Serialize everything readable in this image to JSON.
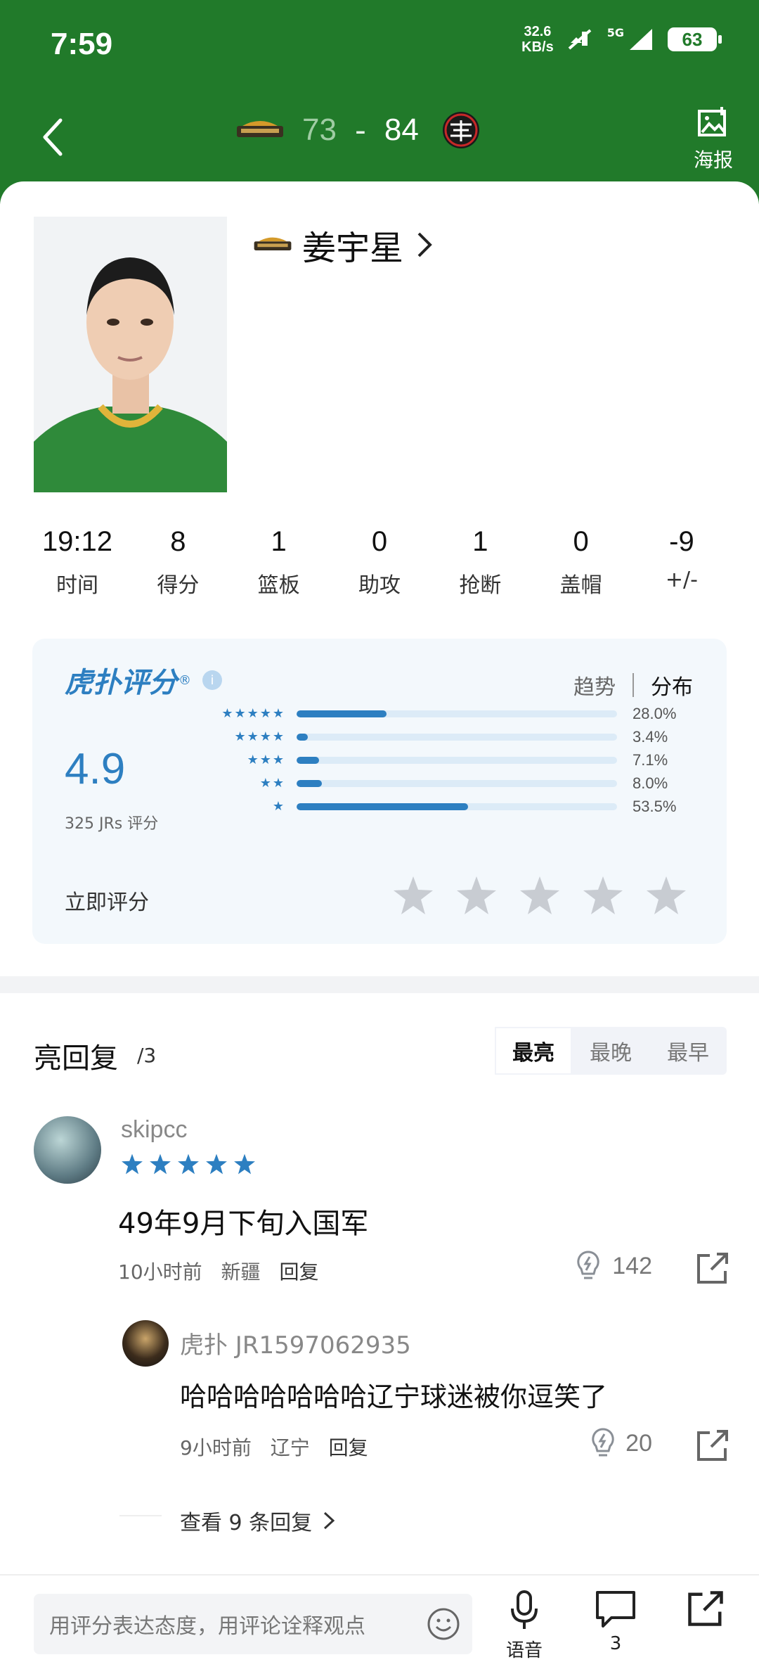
{
  "status_bar": {
    "time": "7:59",
    "net_speed_value": "32.6",
    "net_speed_unit": "KB/s",
    "network": "5G",
    "battery": "63"
  },
  "header": {
    "home_score": "73",
    "separator": "-",
    "away_score": "84",
    "poster_label": "海报"
  },
  "player": {
    "name": "姜宇星"
  },
  "stats": [
    {
      "value": "19:12",
      "label": "时间"
    },
    {
      "value": "8",
      "label": "得分"
    },
    {
      "value": "1",
      "label": "篮板"
    },
    {
      "value": "0",
      "label": "助攻"
    },
    {
      "value": "1",
      "label": "抢断"
    },
    {
      "value": "0",
      "label": "盖帽"
    },
    {
      "value": "-9",
      "label": "+/-"
    }
  ],
  "rating": {
    "brand": "虎扑评分",
    "brand_mark": "®",
    "info": "i",
    "tab_trend": "趋势",
    "tab_distribution": "分布",
    "score": "4.9",
    "count": "325 JRs 评分",
    "rate_now": "立即评分",
    "distribution": [
      {
        "stars": "★★★★★",
        "pct_label": "28.0%",
        "pct": 28.0
      },
      {
        "stars": "★★★★",
        "pct_label": "3.4%",
        "pct": 3.4
      },
      {
        "stars": "★★★",
        "pct_label": "7.1%",
        "pct": 7.1
      },
      {
        "stars": "★★",
        "pct_label": "8.0%",
        "pct": 8.0
      },
      {
        "stars": "★",
        "pct_label": "53.5%",
        "pct": 53.5
      }
    ]
  },
  "replies": {
    "title": "亮回复",
    "count": "/3",
    "sort": [
      "最亮",
      "最晚",
      "最早"
    ],
    "comment": {
      "user": "skipcc",
      "stars": 5,
      "text": "49年9月下旬入国军",
      "time": "10小时前",
      "location": "新疆",
      "reply_label": "回复",
      "likes": "142"
    },
    "subreply": {
      "user": "虎扑 JR1597062935",
      "text": "哈哈哈哈哈哈哈辽宁球迷被你逗笑了",
      "time": "9小时前",
      "location": "辽宁",
      "reply_label": "回复",
      "likes": "20"
    },
    "view_more": "查看 9 条回复"
  },
  "bottom_bar": {
    "input_placeholder": "用评分表达态度，用评论诠释观点",
    "voice_label": "语音",
    "comments_label": "3"
  },
  "colors": {
    "header_green": "#217a2a",
    "accent_blue": "#2d7fc1"
  }
}
